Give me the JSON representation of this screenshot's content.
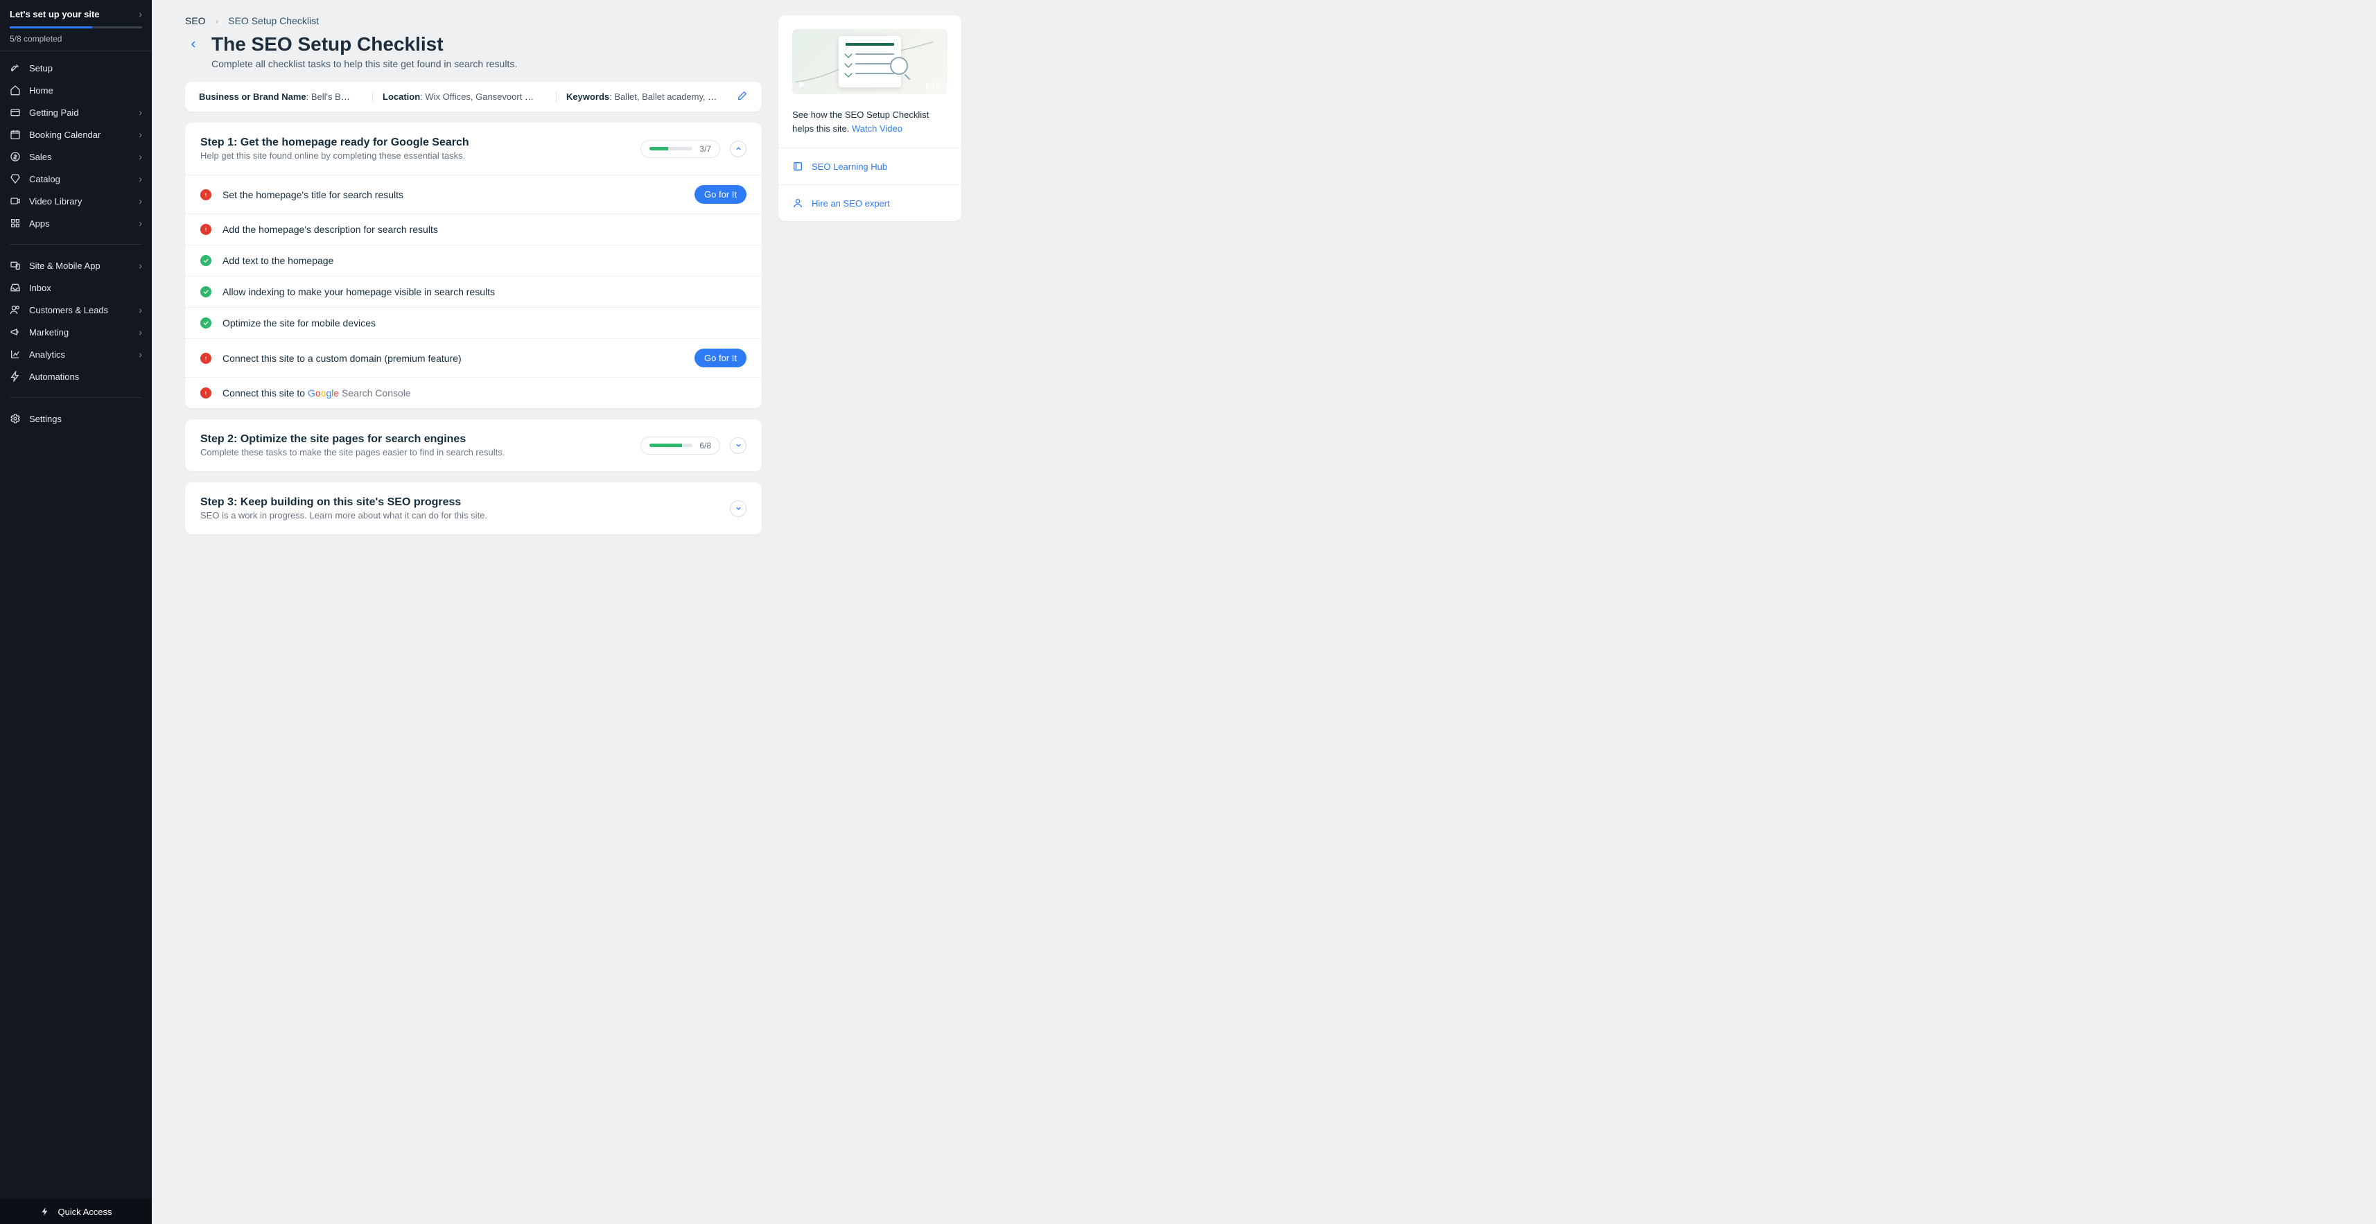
{
  "sidebar": {
    "setup_label": "Let's set up your site",
    "progress_text": "5/8 completed",
    "items": [
      {
        "label": "Setup",
        "chevron": false
      },
      {
        "label": "Home",
        "chevron": false
      },
      {
        "label": "Getting Paid",
        "chevron": true
      },
      {
        "label": "Booking Calendar",
        "chevron": true
      },
      {
        "label": "Sales",
        "chevron": true
      },
      {
        "label": "Catalog",
        "chevron": true
      },
      {
        "label": "Video Library",
        "chevron": true
      },
      {
        "label": "Apps",
        "chevron": true
      }
    ],
    "items2": [
      {
        "label": "Site & Mobile App",
        "chevron": true
      },
      {
        "label": "Inbox",
        "chevron": false
      },
      {
        "label": "Customers & Leads",
        "chevron": true
      },
      {
        "label": "Marketing",
        "chevron": true
      },
      {
        "label": "Analytics",
        "chevron": true
      },
      {
        "label": "Automations",
        "chevron": false
      }
    ],
    "settings_label": "Settings",
    "quick_access": "Quick Access"
  },
  "breadcrumb": {
    "root": "SEO",
    "current": "SEO Setup Checklist"
  },
  "page": {
    "title": "The SEO Setup Checklist",
    "subtitle": "Complete all checklist tasks to help this site get found in search results."
  },
  "kv": {
    "brand_label": "Business or Brand Name",
    "brand_value": ": Bell's Ball...",
    "location_label": "Location",
    "location_value": ": Wix Offices, Gansevoort Street, New Y...",
    "keywords_label": "Keywords",
    "keywords_value": ": Ballet, Ballet academy, Ballet training, Profes..."
  },
  "steps": {
    "s1": {
      "title": "Step 1: Get the homepage ready for Google Search",
      "desc": "Help get this site found online by completing these essential tasks.",
      "count": "3/7",
      "tasks": [
        {
          "status": "err",
          "label": "Set the homepage's title for search results",
          "cta": "Go for It"
        },
        {
          "status": "err",
          "label": "Add the homepage's description for search results"
        },
        {
          "status": "ok",
          "label": "Add text to the homepage"
        },
        {
          "status": "ok",
          "label": "Allow indexing to make your homepage visible in search results"
        },
        {
          "status": "ok",
          "label": "Optimize the site for mobile devices"
        },
        {
          "status": "err",
          "label": "Connect this site to a custom domain (premium feature)",
          "cta": "Go for It"
        },
        {
          "status": "err",
          "label_prefix": "Connect this site to ",
          "google": true,
          "gsc_suffix": " Search Console"
        }
      ]
    },
    "s2": {
      "title": "Step 2: Optimize the site pages for search engines",
      "desc": "Complete these tasks to make the site pages easier to find in search results.",
      "count": "6/8"
    },
    "s3": {
      "title": "Step 3: Keep building on this site's SEO progress",
      "desc": "SEO is a work in progress. Learn more about what it can do for this site."
    }
  },
  "rail": {
    "video_duration": "1:12",
    "copy_prefix": "See how the SEO Setup Checklist helps this site. ",
    "watch_video": "Watch Video",
    "learning_hub": "SEO Learning Hub",
    "hire_expert": "Hire an SEO expert"
  }
}
